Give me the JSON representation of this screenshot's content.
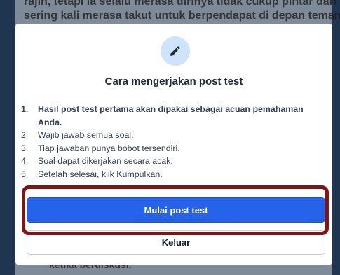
{
  "background": {
    "line1": "rajin, tetapi ia selalu merasa dirinya tidak cukup pintar dan",
    "line2": "sering kali merasa takut untuk berpendapat di depan teman-",
    "line3": "ketika berdiskusi."
  },
  "modal": {
    "icon": "pencil-icon",
    "title": "Cara mengerjakan post test",
    "rules": [
      {
        "num": "1.",
        "text": "Hasil post test pertama akan dipakai sebagai acuan pemahaman Anda."
      },
      {
        "num": "2.",
        "text": "Wajib jawab semua soal."
      },
      {
        "num": "3.",
        "text": "Tiap jawaban punya bobot tersendiri."
      },
      {
        "num": "4.",
        "text": "Soal dapat dikerjakan secara acak."
      },
      {
        "num": "5.",
        "text": "Setelah selesai, klik Kumpulkan."
      }
    ],
    "start_label": "Mulai post test",
    "exit_label": "Keluar"
  },
  "colors": {
    "accent": "#2563eb",
    "highlight": "#8b1010",
    "icon_bg": "#cfe3fb"
  }
}
